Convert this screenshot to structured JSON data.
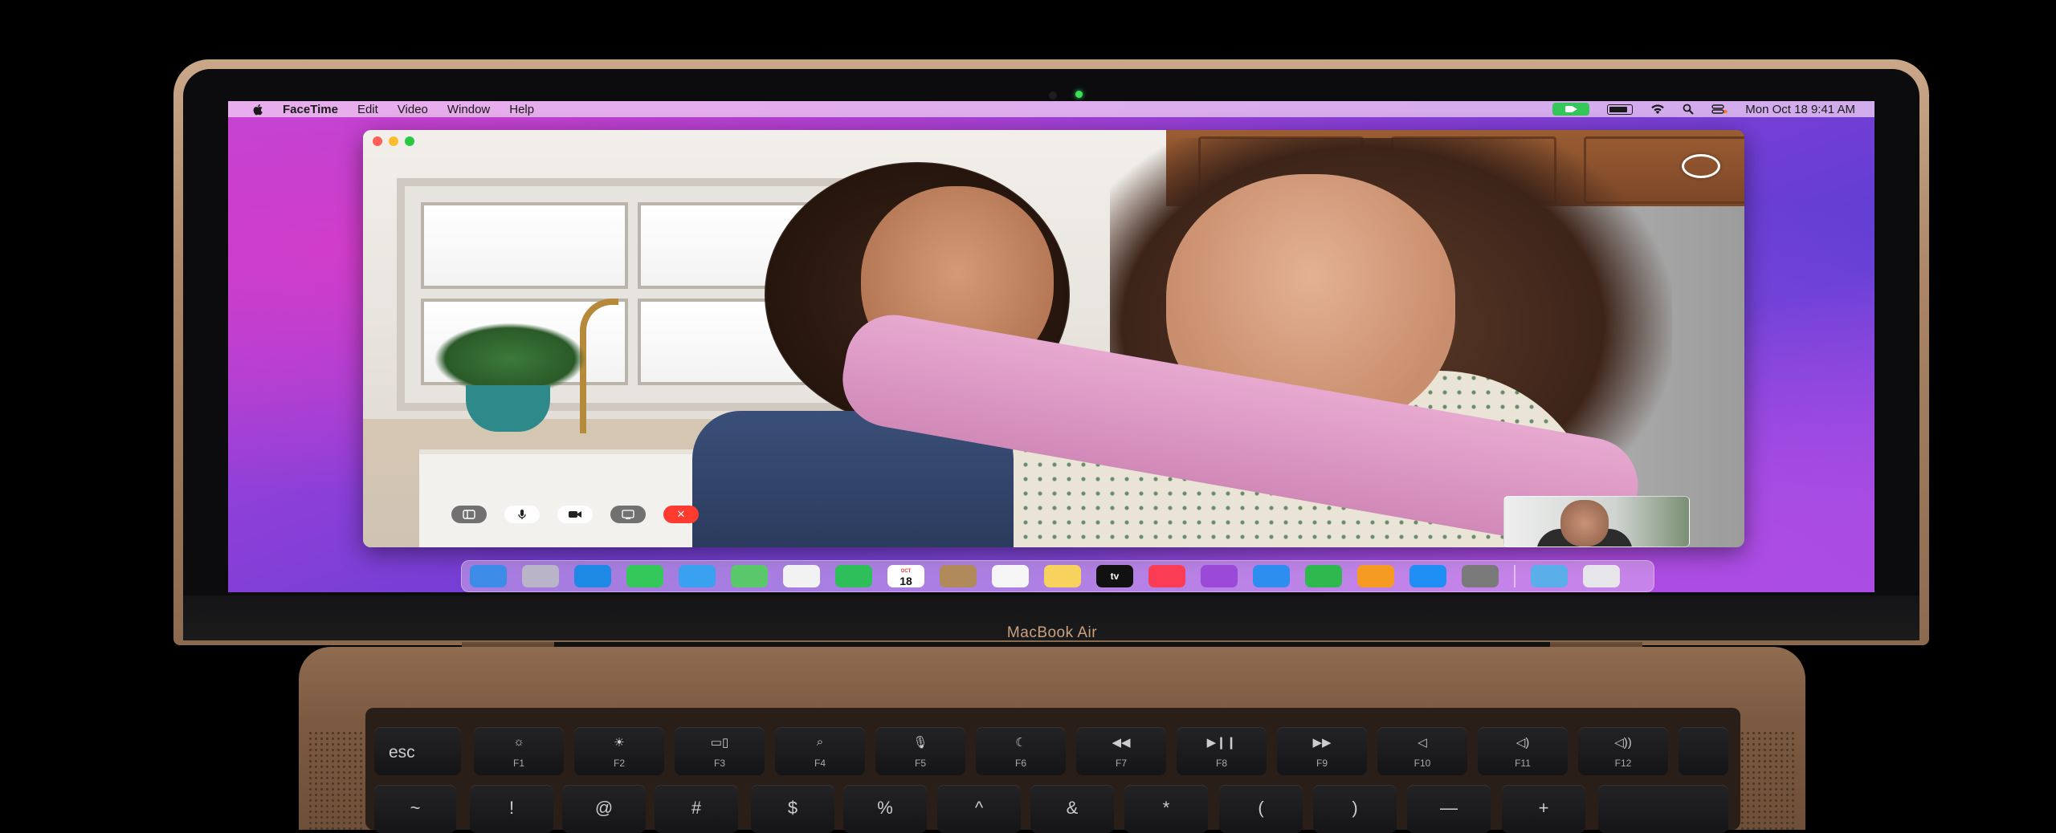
{
  "device": {
    "brand_label": "MacBook Air"
  },
  "menubar": {
    "apple_icon": "apple-logo-icon",
    "app_name": "FaceTime",
    "items": [
      "Edit",
      "Video",
      "Window",
      "Help"
    ],
    "status_icons": [
      "facetime-camera-status-icon",
      "battery-icon",
      "wifi-icon",
      "spotlight-search-icon",
      "control-center-icon"
    ],
    "clock": "Mon Oct 18  9:41 AM"
  },
  "facetime": {
    "controls": [
      "sidebar-icon",
      "microphone-icon",
      "camera-icon",
      "screen-share-icon",
      "end-call-icon"
    ],
    "end_call_glyph": "✕",
    "record_button": "record-button",
    "self_view": "self-view-pip"
  },
  "dock": {
    "apps": [
      {
        "name": "Finder",
        "color": "#3d8ce8"
      },
      {
        "name": "Launchpad",
        "color": "#b9b4c8"
      },
      {
        "name": "Safari",
        "color": "#1e88e5"
      },
      {
        "name": "Messages",
        "color": "#34c759"
      },
      {
        "name": "Mail",
        "color": "#3aa0f0"
      },
      {
        "name": "Maps",
        "color": "#5ac86a"
      },
      {
        "name": "Photos",
        "color": "#f2f2f2"
      },
      {
        "name": "FaceTime",
        "color": "#2fbf5a"
      },
      {
        "name": "Calendar",
        "color": "#ffffff"
      },
      {
        "name": "Contacts",
        "color": "#b08a5a"
      },
      {
        "name": "Reminders",
        "color": "#f5f5f5"
      },
      {
        "name": "Notes",
        "color": "#f7d35e"
      },
      {
        "name": "TV",
        "color": "#111111"
      },
      {
        "name": "Music",
        "color": "#fa3c55"
      },
      {
        "name": "Podcasts",
        "color": "#9b4ad8"
      },
      {
        "name": "Keynote",
        "color": "#2d8ef0"
      },
      {
        "name": "Numbers",
        "color": "#2eb84e"
      },
      {
        "name": "Pages",
        "color": "#f59a23"
      },
      {
        "name": "App Store",
        "color": "#1f8ef5"
      },
      {
        "name": "System Preferences",
        "color": "#7a7a7a"
      }
    ],
    "calendar_month": "OCT",
    "calendar_day": "18",
    "tv_label": "tv",
    "extras": [
      {
        "name": "Downloads",
        "color": "#5aaeea"
      },
      {
        "name": "Trash",
        "color": "#e6e6ea"
      }
    ]
  },
  "keyboard": {
    "fn_row": [
      {
        "label": "esc"
      },
      {
        "icon": "☼",
        "fn": "F1"
      },
      {
        "icon": "☀",
        "fn": "F2"
      },
      {
        "icon": "▭▯",
        "fn": "F3"
      },
      {
        "icon": "⌕",
        "fn": "F4"
      },
      {
        "icon": "🎙",
        "fn": "F5"
      },
      {
        "icon": "☾",
        "fn": "F6"
      },
      {
        "icon": "◀◀",
        "fn": "F7"
      },
      {
        "icon": "▶❙❙",
        "fn": "F8"
      },
      {
        "icon": "▶▶",
        "fn": "F9"
      },
      {
        "icon": "◁",
        "fn": "F10"
      },
      {
        "icon": "◁)",
        "fn": "F11"
      },
      {
        "icon": "◁))",
        "fn": "F12"
      }
    ],
    "number_row": [
      "~",
      "!",
      "@",
      "#",
      "$",
      "%",
      "^",
      "&",
      "*",
      "(",
      ")",
      "—",
      "+"
    ]
  }
}
